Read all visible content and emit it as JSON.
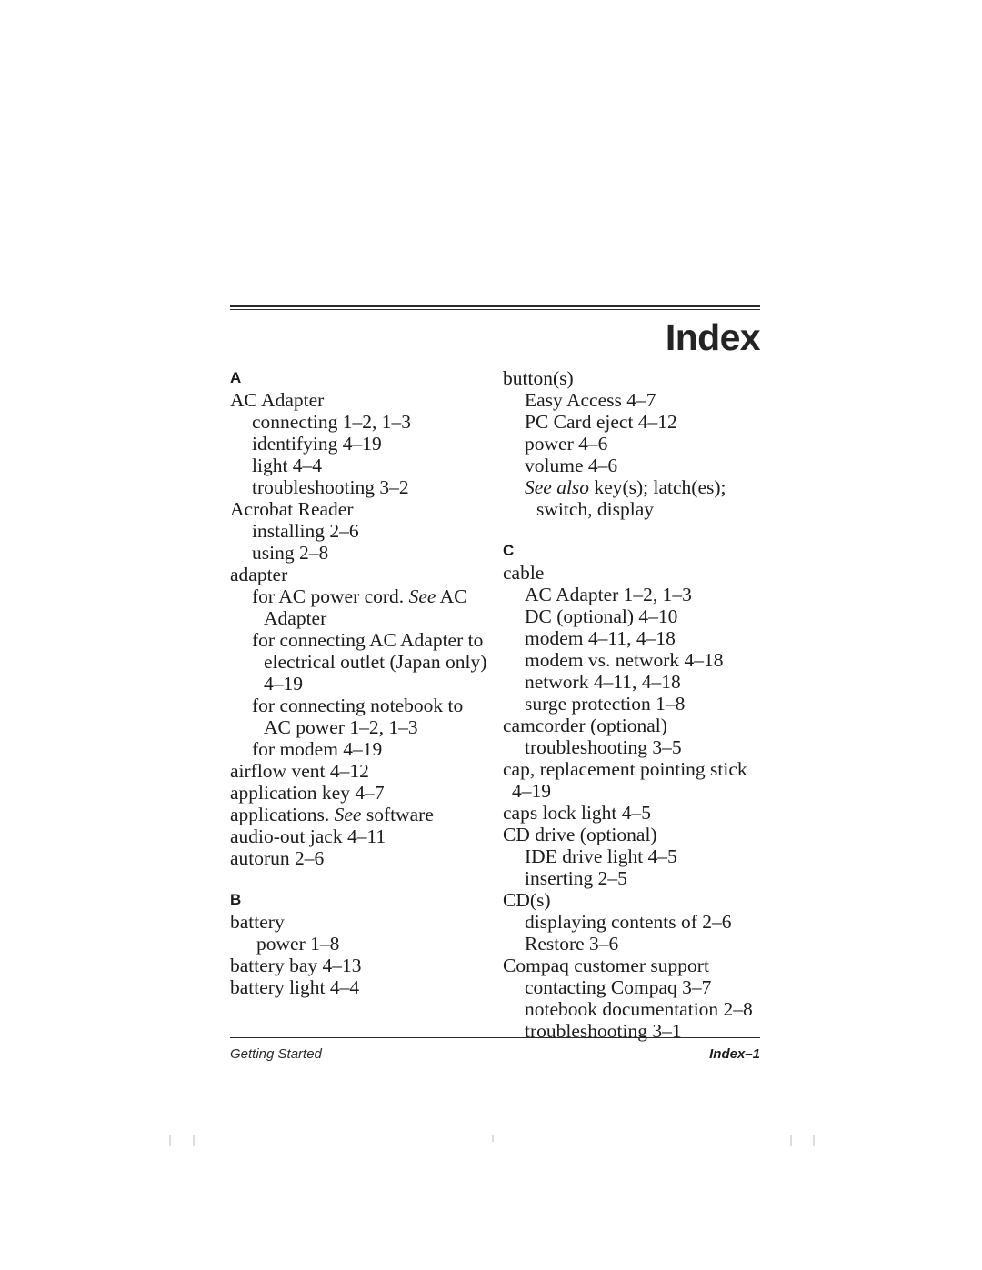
{
  "header": {
    "title": "Index"
  },
  "footer": {
    "left": "Getting Started",
    "right": "Index–1"
  },
  "columns": [
    {
      "name": "left-column",
      "blocks": [
        {
          "type": "letter",
          "label": "A",
          "spaced": false
        },
        {
          "type": "entry",
          "level": 0,
          "text": "AC Adapter"
        },
        {
          "type": "entry",
          "level": 1,
          "text": "connecting 1–2, 1–3"
        },
        {
          "type": "entry",
          "level": 1,
          "text": "identifying 4–19"
        },
        {
          "type": "entry",
          "level": 1,
          "text": "light 4–4"
        },
        {
          "type": "entry",
          "level": 1,
          "text": "troubleshooting 3–2"
        },
        {
          "type": "entry",
          "level": 0,
          "text": "Acrobat Reader"
        },
        {
          "type": "entry",
          "level": 1,
          "text": "installing 2–6"
        },
        {
          "type": "entry",
          "level": 1,
          "text": "using 2–8"
        },
        {
          "type": "entry",
          "level": 0,
          "text": "adapter"
        },
        {
          "type": "entry",
          "level": 1,
          "text": "for AC power cord. See AC Adapter",
          "italic_words": "See"
        },
        {
          "type": "entry",
          "level": 1,
          "text": "for connecting AC Adapter to electrical outlet (Japan only) 4–19"
        },
        {
          "type": "entry",
          "level": 1,
          "text": "for connecting notebook to AC power 1–2, 1–3"
        },
        {
          "type": "entry",
          "level": 1,
          "text": "for modem 4–19"
        },
        {
          "type": "entry",
          "level": 0,
          "text": "airflow vent 4–12"
        },
        {
          "type": "entry",
          "level": 0,
          "text": "application key 4–7"
        },
        {
          "type": "entry",
          "level": 0,
          "text": "applications. See software",
          "italic_words": "See"
        },
        {
          "type": "entry",
          "level": 0,
          "text": "audio-out jack 4–11"
        },
        {
          "type": "entry",
          "level": 0,
          "text": "autorun 2–6"
        },
        {
          "type": "letter",
          "label": "B",
          "spaced": true
        },
        {
          "type": "entry",
          "level": 0,
          "text": "battery"
        },
        {
          "type": "entry",
          "level": "1-deep",
          "text": "power 1–8"
        },
        {
          "type": "entry",
          "level": 0,
          "text": "battery bay 4–13"
        },
        {
          "type": "entry",
          "level": 0,
          "text": "battery light 4–4"
        }
      ]
    },
    {
      "name": "right-column",
      "blocks": [
        {
          "type": "entry",
          "level": 0,
          "text": "button(s)"
        },
        {
          "type": "entry",
          "level": 1,
          "text": "Easy Access 4–7"
        },
        {
          "type": "entry",
          "level": 1,
          "text": "PC Card eject 4–12"
        },
        {
          "type": "entry",
          "level": 1,
          "text": "power 4–6"
        },
        {
          "type": "entry",
          "level": 1,
          "text": "volume 4–6"
        },
        {
          "type": "entry",
          "level": 1,
          "text": "See also key(s); latch(es); switch, display",
          "italic_words": "See also"
        },
        {
          "type": "letter",
          "label": "C",
          "spaced": true
        },
        {
          "type": "entry",
          "level": 0,
          "text": "cable"
        },
        {
          "type": "entry",
          "level": 1,
          "text": "AC Adapter 1–2, 1–3"
        },
        {
          "type": "entry",
          "level": 1,
          "text": "DC (optional) 4–10"
        },
        {
          "type": "entry",
          "level": 1,
          "text": "modem 4–11, 4–18"
        },
        {
          "type": "entry",
          "level": 1,
          "text": "modem vs. network 4–18"
        },
        {
          "type": "entry",
          "level": 1,
          "text": "network 4–11, 4–18"
        },
        {
          "type": "entry",
          "level": 1,
          "text": "surge protection 1–8"
        },
        {
          "type": "entry",
          "level": 0,
          "text": "camcorder (optional)"
        },
        {
          "type": "entry",
          "level": 1,
          "text": "troubleshooting 3–5"
        },
        {
          "type": "entry",
          "level": 0,
          "text": "cap, replacement pointing stick 4–19"
        },
        {
          "type": "entry",
          "level": 0,
          "text": "caps lock light 4–5"
        },
        {
          "type": "entry",
          "level": 0,
          "text": "CD drive (optional)"
        },
        {
          "type": "entry",
          "level": 1,
          "text": "IDE drive light 4–5"
        },
        {
          "type": "entry",
          "level": 1,
          "text": "inserting 2–5"
        },
        {
          "type": "entry",
          "level": 0,
          "text": "CD(s)"
        },
        {
          "type": "entry",
          "level": 1,
          "text": "displaying contents of 2–6"
        },
        {
          "type": "entry",
          "level": 1,
          "text": "Restore 3–6"
        },
        {
          "type": "entry",
          "level": 0,
          "text": "Compaq customer support"
        },
        {
          "type": "entry",
          "level": 1,
          "text": "contacting Compaq 3–7"
        },
        {
          "type": "entry",
          "level": 1,
          "text": "notebook documentation 2–8"
        },
        {
          "type": "entry",
          "level": 1,
          "text": "troubleshooting 3–1"
        }
      ]
    }
  ]
}
